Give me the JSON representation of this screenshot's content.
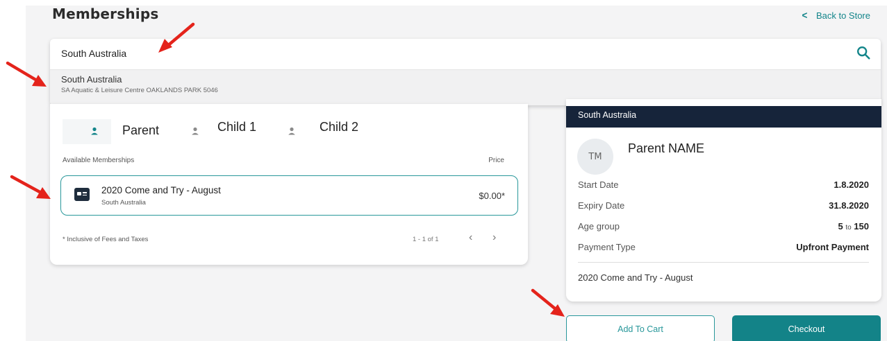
{
  "page": {
    "title": "Memberships"
  },
  "header": {
    "back_label": "Back to Store"
  },
  "search": {
    "value": "South Australia",
    "suggestion": {
      "title": "South Australia",
      "subtitle": "SA Aquatic & Leisure Centre OAKLANDS PARK 5046"
    }
  },
  "tabs": [
    {
      "label": "Parent",
      "active": true
    },
    {
      "label": "Child 1",
      "active": false
    },
    {
      "label": "Child 2",
      "active": false
    }
  ],
  "memberships": {
    "available_label": "Available Memberships",
    "price_label": "Price",
    "items": [
      {
        "title": "2020 Come and Try - August",
        "subtitle": "South Australia",
        "price": "$0.00*"
      }
    ],
    "footnote": "* Inclusive of Fees and Taxes",
    "pagination": "1 - 1 of 1"
  },
  "summary": {
    "header": "South Australia",
    "avatar_initials": "TM",
    "name": "Parent NAME",
    "details": [
      {
        "label": "Start Date",
        "value": "1.8.2020"
      },
      {
        "label": "Expiry Date",
        "value": "31.8.2020"
      },
      {
        "label": "Age group",
        "value_from": "5",
        "value_sep": "to",
        "value_to": "150"
      },
      {
        "label": "Payment Type",
        "value": "Upfront Payment"
      }
    ],
    "membership_name": "2020 Come and Try - August"
  },
  "actions": {
    "add_to_cart": "Add To Cart",
    "checkout": "Checkout"
  },
  "colors": {
    "accent": "#13858a",
    "header_dark": "#16243a",
    "annotation_arrow": "#e4231b"
  },
  "icons": [
    "chevron-left-icon",
    "search-icon",
    "person-icon",
    "membership-card-icon",
    "chevron-right-icon",
    "arrow-annotation"
  ]
}
